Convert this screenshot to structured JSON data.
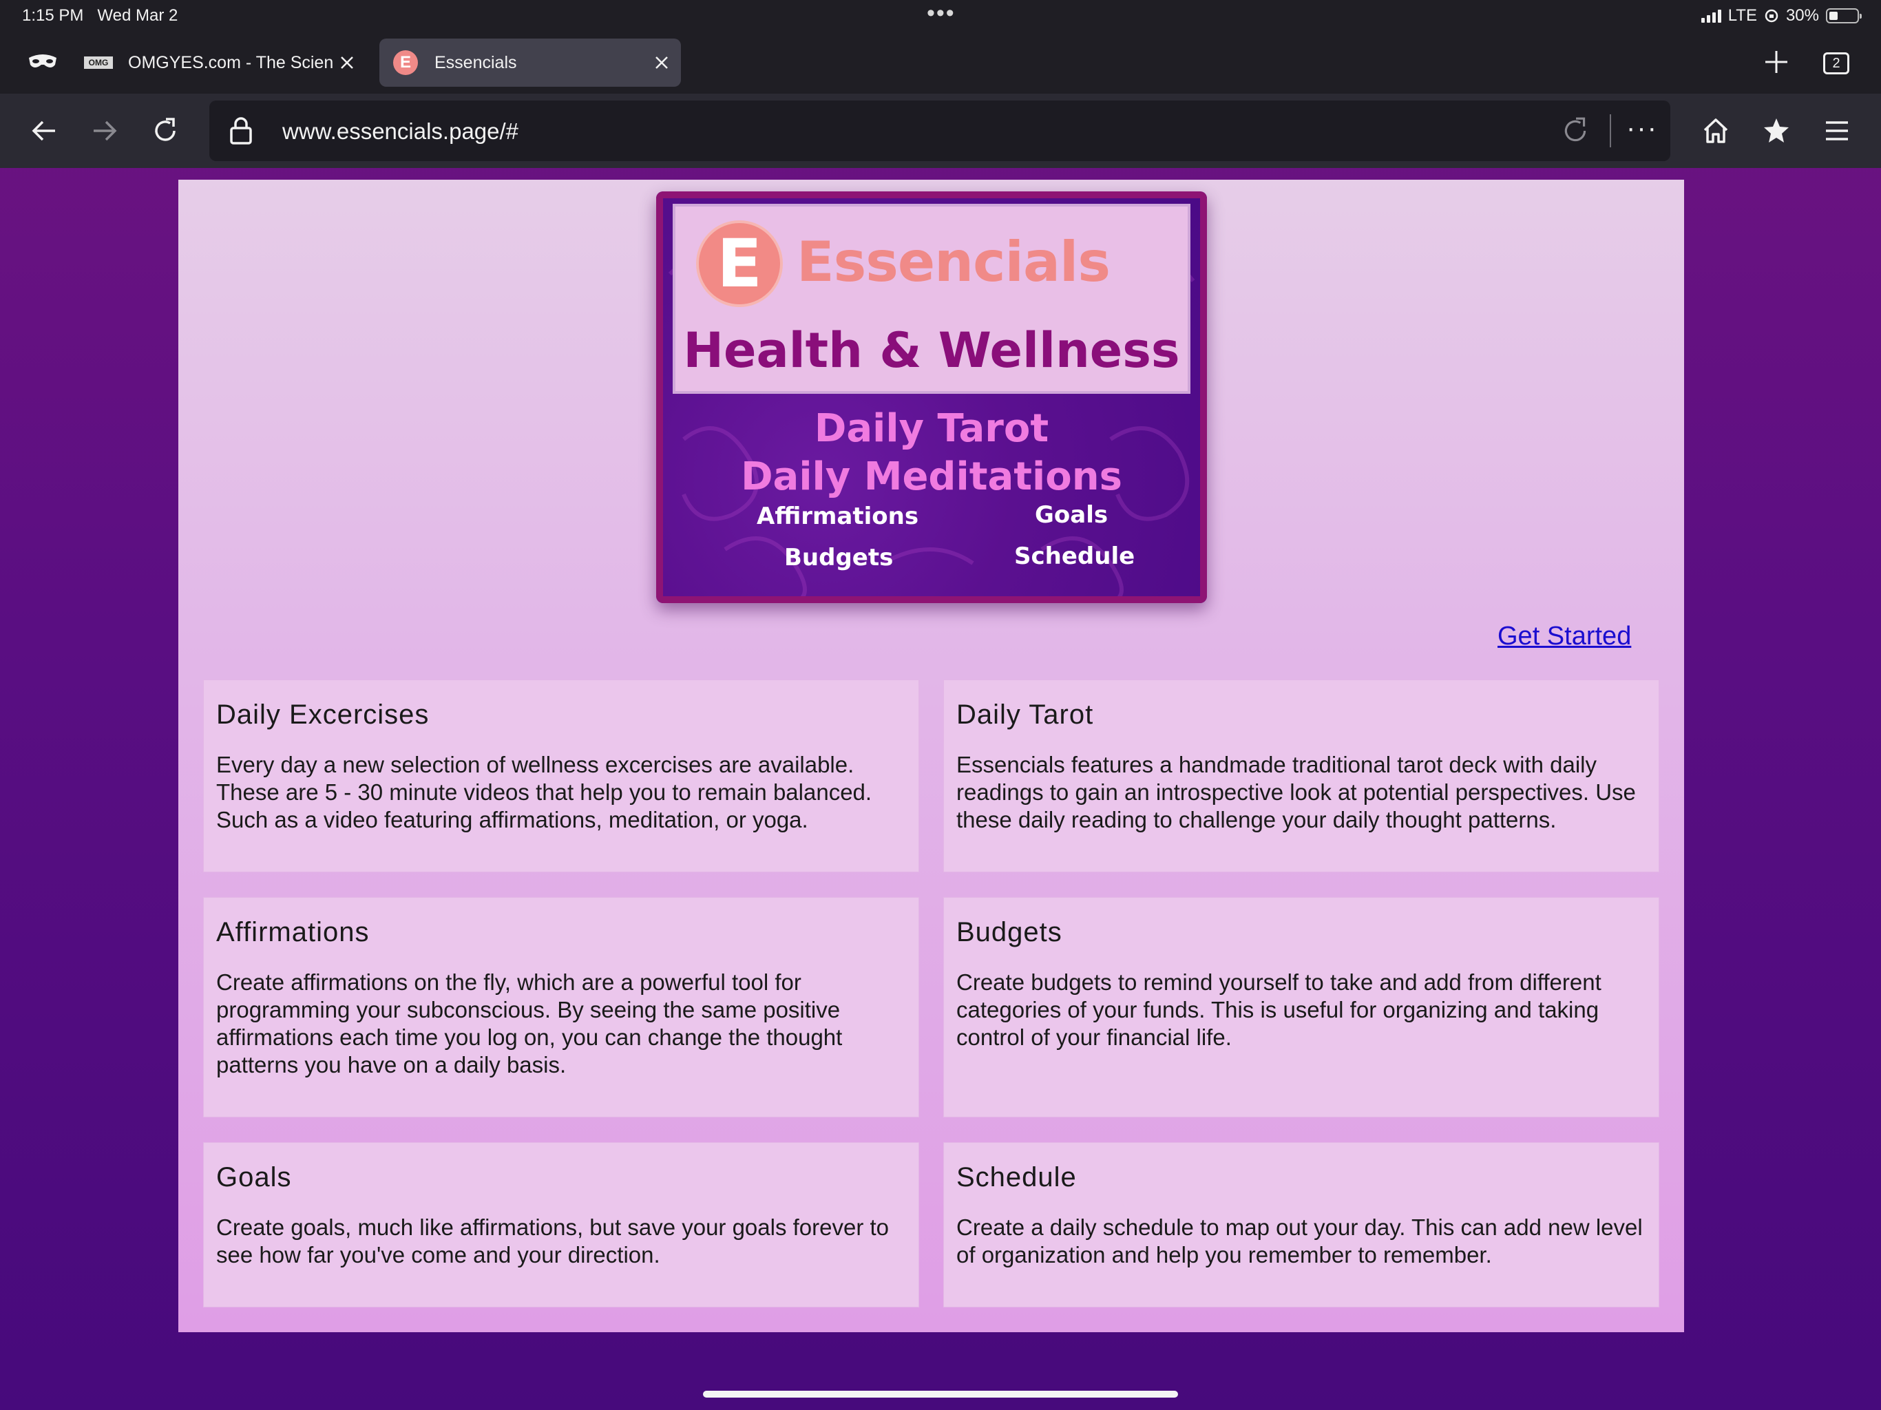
{
  "status_bar": {
    "time": "1:15 PM",
    "date": "Wed Mar 2",
    "network": "LTE",
    "battery": "30%",
    "center": "•••"
  },
  "tabs": [
    {
      "favicon": "OMG",
      "title": "OMGYES.com - The Science"
    },
    {
      "favicon": "E",
      "title": "Essencials",
      "active": true
    }
  ],
  "tab_count": "2",
  "address_bar": {
    "url": "www.essencials.page/#",
    "more": "···"
  },
  "banner": {
    "logo_letter": "E",
    "logo_text": "Essencials",
    "tagline": "Health & Wellness",
    "line1": "Daily Tarot",
    "line2": "Daily Meditations",
    "items": [
      "Affirmations",
      "Goals",
      "Budgets",
      "Schedule"
    ]
  },
  "get_started": "Get Started",
  "cards": [
    {
      "title": "Daily Excercises",
      "body": "Every day a new selection of wellness excercises are available. These are 5 - 30 minute videos that help you to remain balanced. Such as a video featuring affirmations, meditation, or yoga."
    },
    {
      "title": "Daily Tarot",
      "body": "Essencials features a handmade traditional tarot deck with daily readings to gain an introspective look at potential perspectives. Use these daily reading to challenge your daily thought patterns."
    },
    {
      "title": "Affirmations",
      "body": "Create affirmations on the fly, which are a powerful tool for programming your subconscious. By seeing the same positive affirmations each time you log on, you can change the thought patterns you have on a daily basis."
    },
    {
      "title": "Budgets",
      "body": "Create budgets to remind yourself to take and add from different categories of your funds. This is useful for organizing and taking control of your financial life."
    },
    {
      "title": "Goals",
      "body": "Create goals, much like affirmations, but save your goals forever to see how far you've come and your direction."
    },
    {
      "title": "Schedule",
      "body": "Create a daily schedule to map out your day. This can add new level of organization and help you remember to remember."
    }
  ],
  "colors": {
    "accent": "#f08a88",
    "brand_purple": "#5b1090",
    "link": "#1a0dcf"
  }
}
